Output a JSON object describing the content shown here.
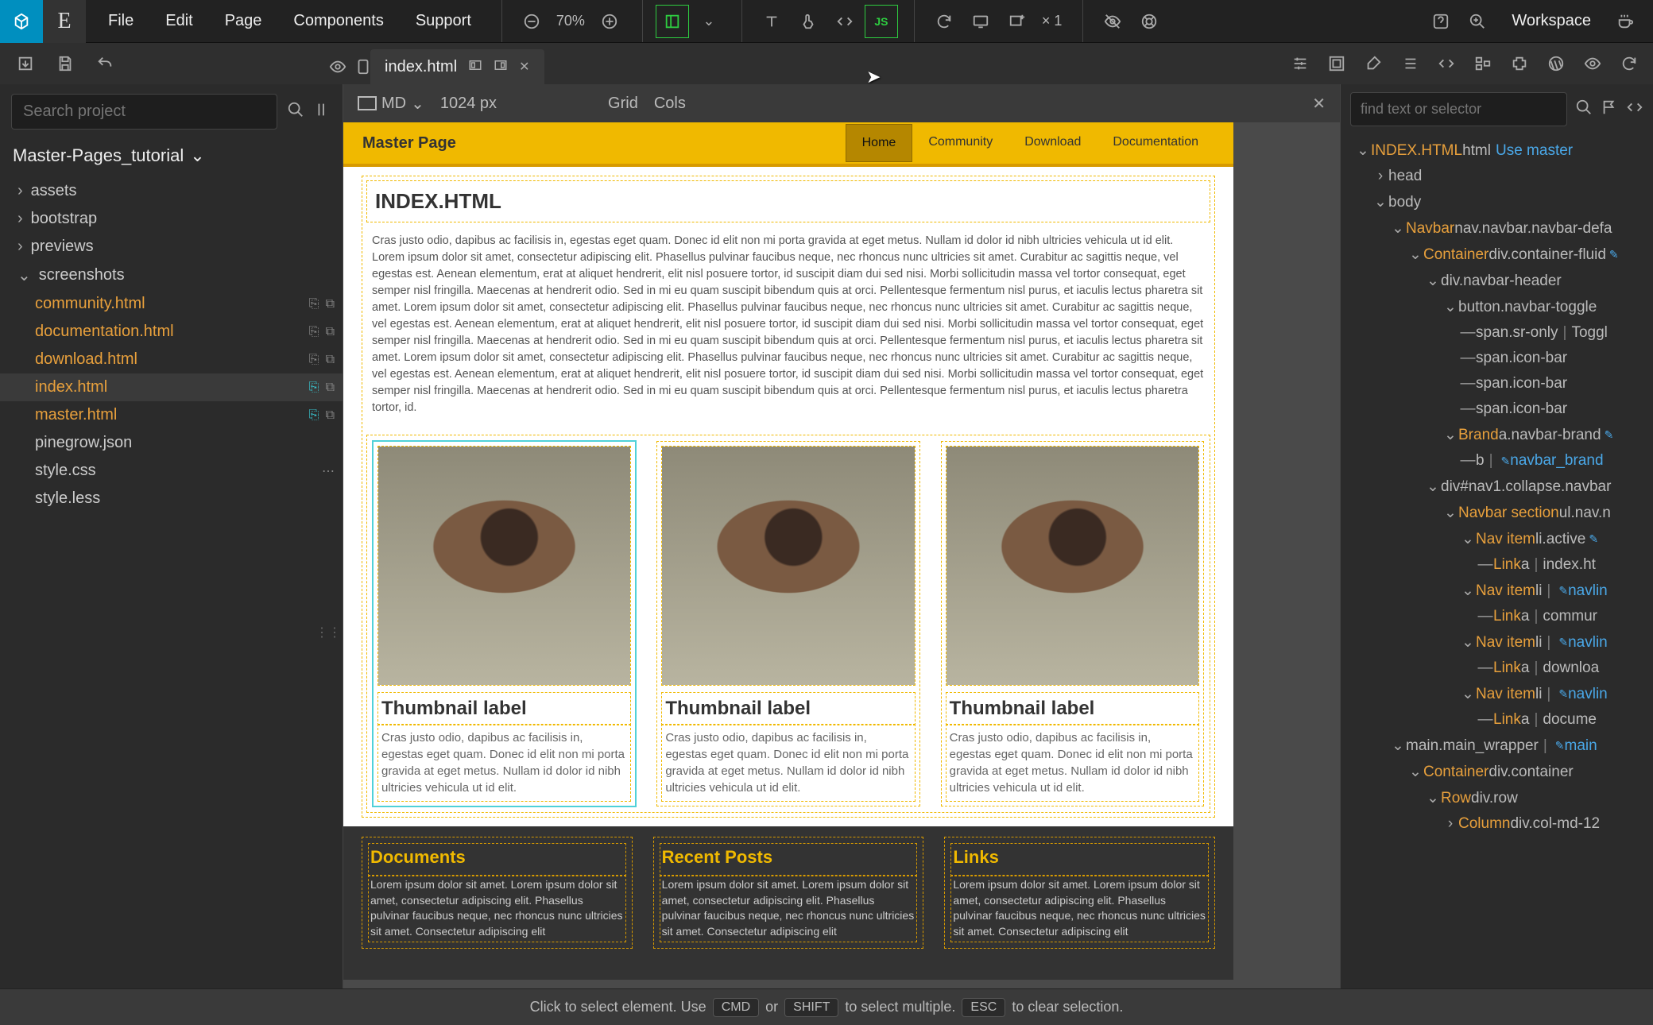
{
  "menu": {
    "items": [
      "File",
      "Edit",
      "Page",
      "Components",
      "Support"
    ]
  },
  "zoom": {
    "pct": "70%",
    "mult": "× 1"
  },
  "workspace_label": "Workspace",
  "tab": {
    "title": "index.html"
  },
  "search": {
    "placeholder": "Search project"
  },
  "project_name": "Master-Pages_tutorial",
  "folders": [
    "assets",
    "bootstrap",
    "previews",
    "screenshots"
  ],
  "files": [
    {
      "name": "community.html",
      "orange": true,
      "icons": true
    },
    {
      "name": "documentation.html",
      "orange": true,
      "icons": true
    },
    {
      "name": "download.html",
      "orange": true,
      "icons": true
    },
    {
      "name": "index.html",
      "orange": true,
      "icons": true,
      "selected": true,
      "cyan": true
    },
    {
      "name": "master.html",
      "orange": true,
      "icons": true,
      "cyan": true
    },
    {
      "name": "pinegrow.json",
      "orange": false
    },
    {
      "name": "style.css",
      "orange": false,
      "dots": true
    },
    {
      "name": "style.less",
      "orange": false
    }
  ],
  "viewport": {
    "size_label": "MD",
    "px": "1024 px",
    "grid": "Grid",
    "cols": "Cols"
  },
  "preview": {
    "title": "Master Page",
    "nav": [
      "Home",
      "Community",
      "Download",
      "Documentation"
    ],
    "h1": "INDEX.HTML",
    "para": "Cras justo odio, dapibus ac facilisis in, egestas eget quam. Donec id elit non mi porta gravida at eget metus. Nullam id dolor id nibh ultricies vehicula ut id elit. Lorem ipsum dolor sit amet, consectetur adipiscing elit. Phasellus pulvinar faucibus neque, nec rhoncus nunc ultricies sit amet. Curabitur ac sagittis neque, vel egestas est. Aenean elementum, erat at aliquet hendrerit, elit nisl posuere tortor, id suscipit diam dui sed nisi. Morbi sollicitudin massa vel tortor consequat, eget semper nisl fringilla. Maecenas at hendrerit odio. Sed in mi eu quam suscipit bibendum quis at orci. Pellentesque fermentum nisl purus, et iaculis lectus pharetra sit amet. Lorem ipsum dolor sit amet, consectetur adipiscing elit. Phasellus pulvinar faucibus neque, nec rhoncus nunc ultricies sit amet. Curabitur ac sagittis neque, vel egestas est. Aenean elementum, erat at aliquet hendrerit, elit nisl posuere tortor, id suscipit diam dui sed nisi. Morbi sollicitudin massa vel tortor consequat, eget semper nisl fringilla. Maecenas at hendrerit odio. Sed in mi eu quam suscipit bibendum quis at orci. Pellentesque fermentum nisl purus, et iaculis lectus pharetra sit amet. Lorem ipsum dolor sit amet, consectetur adipiscing elit. Phasellus pulvinar faucibus neque, nec rhoncus nunc ultricies sit amet. Curabitur ac sagittis neque, vel egestas est. Aenean elementum, erat at aliquet hendrerit, elit nisl posuere tortor, id suscipit diam dui sed nisi. Morbi sollicitudin massa vel tortor consequat, eget semper nisl fringilla. Maecenas at hendrerit odio. Sed in mi eu quam suscipit bibendum quis at orci. Pellentesque fermentum nisl purus, et iaculis lectus pharetra tortor, id.",
    "thumb_label": "Thumbnail label",
    "thumb_text": "Cras justo odio, dapibus ac facilisis in, egestas eget quam. Donec id elit non mi porta gravida at eget metus. Nullam id dolor id nibh ultricies vehicula ut id elit.",
    "footer_cols": [
      {
        "h": "Documents",
        "p": "Lorem ipsum dolor sit amet. Lorem ipsum dolor sit amet, consectetur adipiscing elit. Phasellus pulvinar faucibus neque, nec rhoncus nunc ultricies sit amet. Consectetur adipiscing elit"
      },
      {
        "h": "Recent Posts",
        "p": "Lorem ipsum dolor sit amet. Lorem ipsum dolor sit amet, consectetur adipiscing elit. Phasellus pulvinar faucibus neque, nec rhoncus nunc ultricies sit amet. Consectetur adipiscing elit"
      },
      {
        "h": "Links",
        "p": "Lorem ipsum dolor sit amet. Lorem ipsum dolor sit amet, consectetur adipiscing elit. Phasellus pulvinar faucibus neque, nec rhoncus nunc ultricies sit amet. Consectetur adipiscing elit"
      }
    ]
  },
  "rp_search": {
    "placeholder": "find text or selector"
  },
  "dom": [
    {
      "ind": 1,
      "arrow": "⌄",
      "o": "INDEX.HTML",
      "g": "html",
      "btn": "Use master"
    },
    {
      "ind": 2,
      "arrow": "›",
      "g": "head"
    },
    {
      "ind": 2,
      "arrow": "⌄",
      "g": "body"
    },
    {
      "ind": 3,
      "arrow": "⌄",
      "o": "Navbar",
      "g": "nav.navbar.navbar-defa"
    },
    {
      "ind": 4,
      "arrow": "⌄",
      "o": "Container",
      "g": "div.container-fluid",
      "pencil": true
    },
    {
      "ind": 5,
      "arrow": "⌄",
      "g": "div.navbar-header"
    },
    {
      "ind": 6,
      "arrow": "⌄",
      "g": "button.navbar-toggle"
    },
    {
      "ind": 7,
      "arrow": "—",
      "g": "span.sr-only",
      "sep": "|",
      "g2": "Toggl"
    },
    {
      "ind": 7,
      "arrow": "—",
      "g": "span.icon-bar"
    },
    {
      "ind": 7,
      "arrow": "—",
      "g": "span.icon-bar"
    },
    {
      "ind": 7,
      "arrow": "—",
      "g": "span.icon-bar"
    },
    {
      "ind": 6,
      "arrow": "⌄",
      "o": "Brand",
      "g": "a.navbar-brand",
      "pencil": true
    },
    {
      "ind": 7,
      "arrow": "—",
      "g": "b",
      "sep": "|",
      "c": "navbar_brand",
      "pencil": true
    },
    {
      "ind": 5,
      "arrow": "⌄",
      "g": "div#nav1.collapse.navbar"
    },
    {
      "ind": 6,
      "arrow": "⌄",
      "o": "Navbar section",
      "g": "ul.nav.n"
    },
    {
      "ind": 7,
      "arrow": "⌄",
      "o": "Nav item",
      "g": "li.active",
      "pencil": true
    },
    {
      "ind": 8,
      "arrow": "—",
      "o": "Link",
      "g": "a",
      "sep": "|",
      "g2": "index.ht"
    },
    {
      "ind": 7,
      "arrow": "⌄",
      "o": "Nav item",
      "g": "li",
      "sep": "|",
      "c": "navlin",
      "pencil": true
    },
    {
      "ind": 8,
      "arrow": "—",
      "o": "Link",
      "g": "a",
      "sep": "|",
      "g2": "commur"
    },
    {
      "ind": 7,
      "arrow": "⌄",
      "o": "Nav item",
      "g": "li",
      "sep": "|",
      "c": "navlin",
      "pencil": true
    },
    {
      "ind": 8,
      "arrow": "—",
      "o": "Link",
      "g": "a",
      "sep": "|",
      "g2": "downloa"
    },
    {
      "ind": 7,
      "arrow": "⌄",
      "o": "Nav item",
      "g": "li",
      "sep": "|",
      "c": "navlin",
      "pencil": true
    },
    {
      "ind": 8,
      "arrow": "—",
      "o": "Link",
      "g": "a",
      "sep": "|",
      "g2": "docume"
    },
    {
      "ind": 3,
      "arrow": "⌄",
      "g": "main.main_wrapper",
      "sep": "|",
      "c": "main",
      "pencil": true
    },
    {
      "ind": 4,
      "arrow": "⌄",
      "o": "Container",
      "g": "div.container"
    },
    {
      "ind": 5,
      "arrow": "⌄",
      "o": "Row",
      "g": "div.row"
    },
    {
      "ind": 6,
      "arrow": "›",
      "o": "Column",
      "g": "div.col-md-12"
    }
  ],
  "status": {
    "pre": "Click to select element. Use",
    "k1": "CMD",
    "or": "or",
    "k2": "SHIFT",
    "mid": "to select multiple.",
    "k3": "ESC",
    "post": "to clear selection."
  }
}
